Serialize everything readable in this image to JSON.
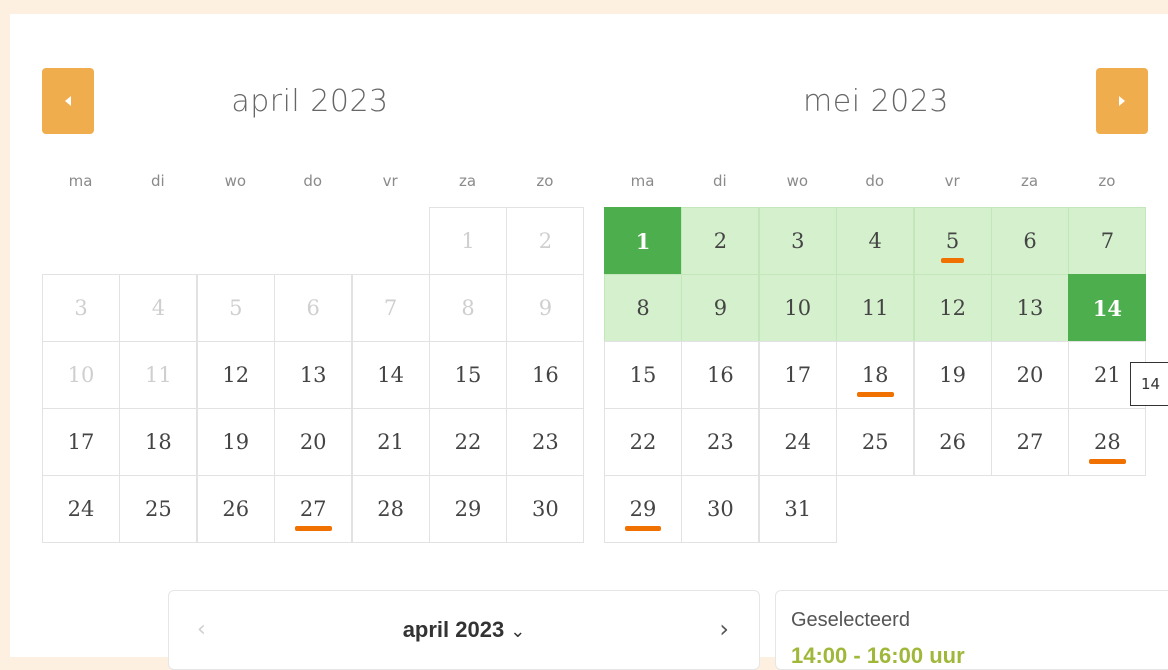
{
  "calendar": {
    "left_month": {
      "title": "april 2023"
    },
    "right_month": {
      "title": "mei 2023"
    },
    "weekdays": [
      "ma",
      "di",
      "wo",
      "do",
      "vr",
      "za",
      "zo"
    ],
    "tooltip": "14"
  },
  "mini_nav": {
    "prev": "‹",
    "title": "april 2023",
    "chevron": "⌄",
    "next": "›"
  },
  "selected": {
    "label": "Geselecteerd",
    "value": "14:00 - 16:00 uur"
  },
  "colors": {
    "accent": "#f0ad4e",
    "selected": "#4cae4c",
    "range": "#d5f0cd",
    "marker": "#f07000"
  }
}
